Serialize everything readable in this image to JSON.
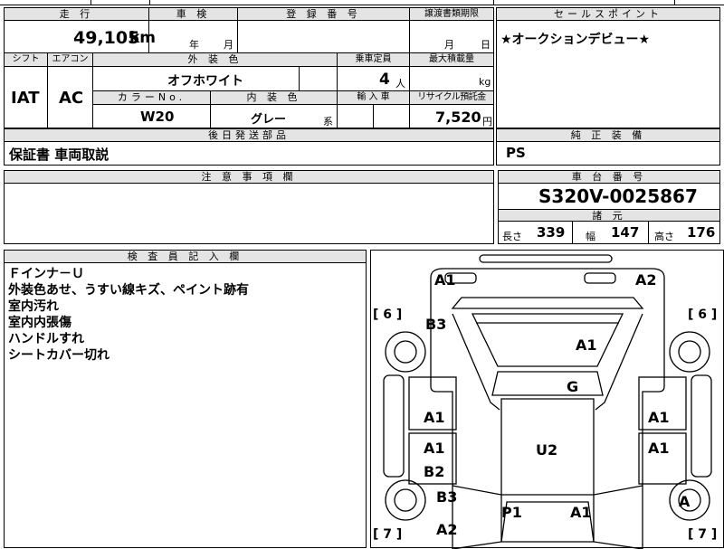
{
  "top_clip": {
    "left": "",
    "mid": "",
    "right": ""
  },
  "headers": {
    "mileage": "走 行",
    "inspection": "車 検",
    "registration": "登 録 番 号",
    "transfer_deadline": "譲渡書類期限",
    "sales_point": "セールスポイント",
    "shift": "シフト",
    "aircon": "エアコン",
    "exterior_color": "外 装 色",
    "capacity": "乗車定員",
    "max_load": "最大積載量",
    "color_no": "カラーNo.",
    "interior_color": "内 装 色",
    "import": "輸 入 車",
    "recycle_fee": "リサイクル預託金",
    "later_shipping": "後日発送部品",
    "equipment": "純 正 装 備",
    "notes": "注 意 事 項 欄",
    "chassis_no": "車 台 番 号",
    "specs": "諸 元",
    "inspector_notes": "検 査 員 記 入 欄"
  },
  "values": {
    "mileage": "49,105",
    "mileage_unit": "km",
    "inspection_year": "年",
    "inspection_month": "月",
    "transfer_month": "月",
    "transfer_day": "日",
    "sales_point": "★オークションデビュー★",
    "shift": "IAT",
    "aircon": "AC",
    "exterior_color": "オフホワイト",
    "capacity": "4",
    "capacity_unit": "人",
    "max_load_unit": "kg",
    "color_no": "W20",
    "interior_color": "グレー",
    "interior_suffix": "系",
    "recycle_fee": "7,520",
    "recycle_unit": "円",
    "later_shipping": "保証書 車両取説",
    "equipment": "PS",
    "chassis_no": "S320V-0025867",
    "length_label": "長さ",
    "length": "339",
    "width_label": "幅",
    "width": "147",
    "height_label": "高さ",
    "height": "176",
    "inspector_lines": [
      "Ｆインナ－Ｕ",
      "外装色あせ、うすい線キズ、ペイント跡有",
      "室内汚れ",
      "室内内張傷",
      "ハンドルすれ",
      "シートカバー切れ"
    ]
  },
  "diagram": {
    "tire_fl": "[ 6 ]",
    "tire_fr": "[ 6 ]",
    "tire_rl": "[ 7 ]",
    "tire_rr": "[ 7 ]",
    "marks": [
      "A1",
      "A2",
      "B3",
      "A1",
      "G",
      "A1",
      "A1",
      "A1",
      "A1",
      "B2",
      "U2",
      "B3",
      "A",
      "P1",
      "A1",
      "A2"
    ]
  }
}
